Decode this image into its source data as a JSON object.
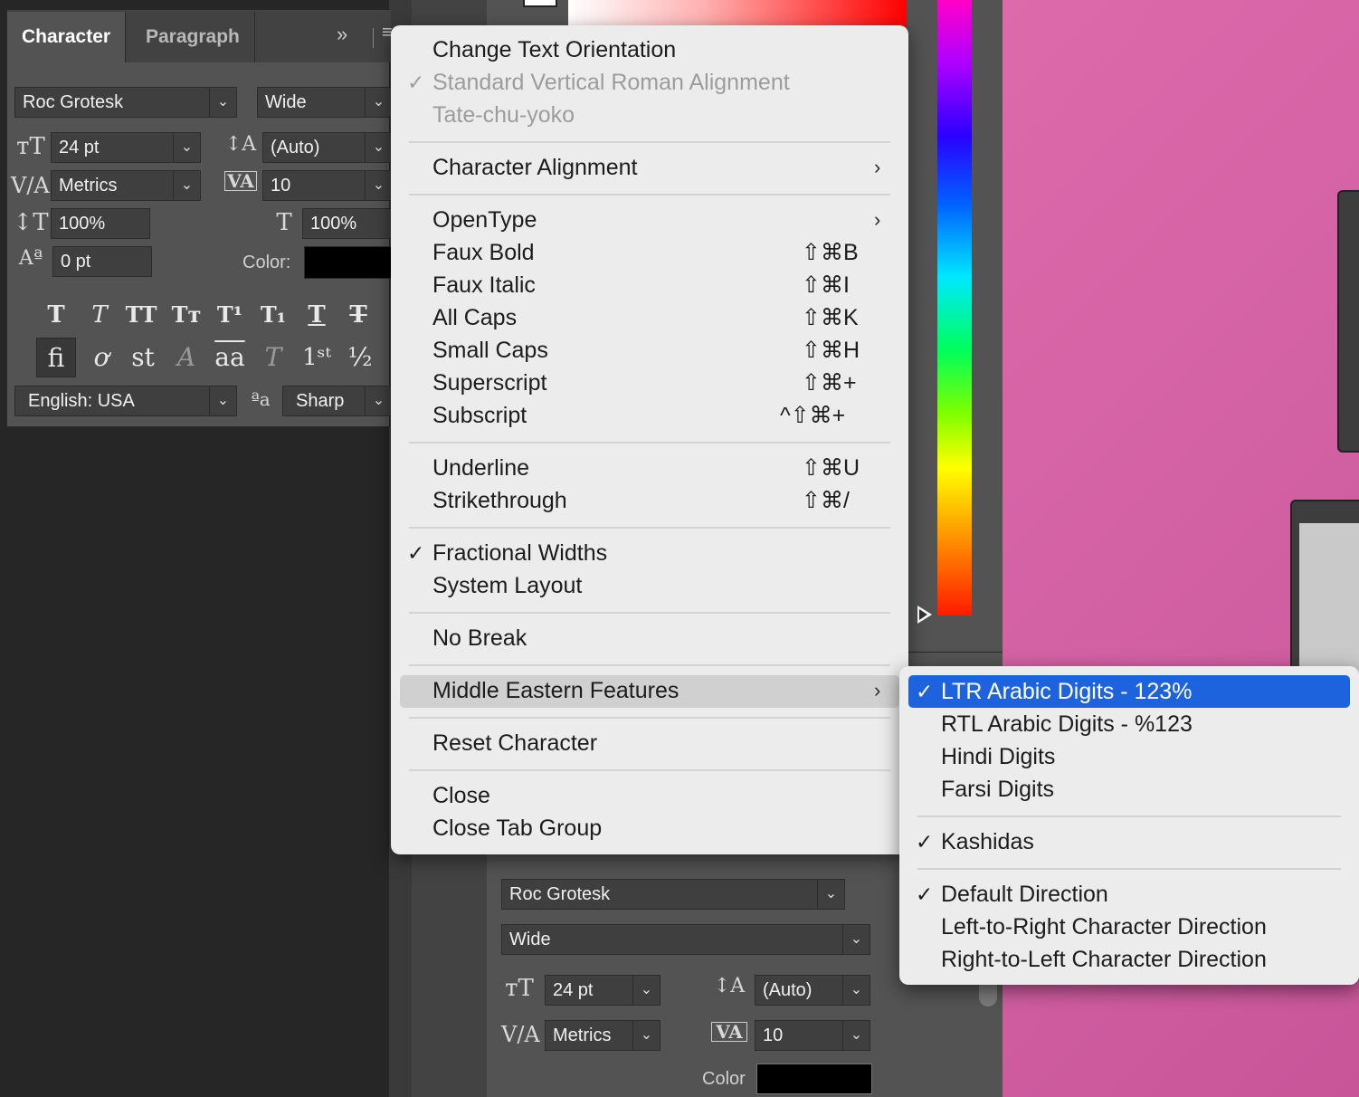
{
  "character_panel": {
    "tabs": [
      {
        "label": "Character"
      },
      {
        "label": "Paragraph"
      }
    ],
    "font_family": "Roc Grotesk",
    "font_style": "Wide",
    "font_size": "24 pt",
    "leading": "(Auto)",
    "kerning": "Metrics",
    "tracking": "10",
    "vertical_scale": "100%",
    "horizontal_scale": "100%",
    "baseline_shift": "0 pt",
    "color_label": "Color:",
    "color_value": "#000000",
    "language": "English: USA",
    "antialias": "Sharp"
  },
  "context_menu": {
    "items": [
      {
        "label": "Change Text Orientation"
      },
      {
        "label": "Standard Vertical Roman Alignment",
        "checked": true,
        "disabled": true
      },
      {
        "label": "Tate-chu-yoko",
        "disabled": true
      },
      {
        "label": "Character Alignment",
        "submenu": true
      },
      {
        "label": "OpenType",
        "submenu": true
      },
      {
        "label": "Faux Bold",
        "shortcut": "⇧⌘B"
      },
      {
        "label": "Faux Italic",
        "shortcut": "⇧⌘I"
      },
      {
        "label": "All Caps",
        "shortcut": "⇧⌘K"
      },
      {
        "label": "Small Caps",
        "shortcut": "⇧⌘H"
      },
      {
        "label": "Superscript",
        "shortcut": "⇧⌘+"
      },
      {
        "label": "Subscript",
        "shortcut": "^⇧⌘+"
      },
      {
        "label": "Underline",
        "shortcut": "⇧⌘U"
      },
      {
        "label": "Strikethrough",
        "shortcut": "⇧⌘/"
      },
      {
        "label": "Fractional Widths",
        "checked": true
      },
      {
        "label": "System Layout"
      },
      {
        "label": "No Break"
      },
      {
        "label": "Middle Eastern Features",
        "submenu": true,
        "highlighted": true
      },
      {
        "label": "Reset Character"
      },
      {
        "label": "Close"
      },
      {
        "label": "Close Tab Group"
      }
    ],
    "checkmark": "✓",
    "submenu_arrow": "›"
  },
  "submenu": {
    "items": [
      {
        "label": "LTR Arabic Digits - 123%",
        "checked": true,
        "highlighted": true
      },
      {
        "label": "RTL Arabic Digits - %123"
      },
      {
        "label": "Hindi Digits"
      },
      {
        "label": "Farsi Digits"
      },
      {
        "label": "Kashidas",
        "checked": true
      },
      {
        "label": "Default Direction",
        "checked": true
      },
      {
        "label": "Left-to-Right Character Direction"
      },
      {
        "label": "Right-to-Left Character Direction"
      }
    ]
  },
  "lower_panel": {
    "font_family": "Roc Grotesk",
    "font_style": "Wide",
    "font_size": "24 pt",
    "leading": "(Auto)",
    "kerning": "Metrics",
    "tracking": "10",
    "color_label": "Color",
    "color_value": "#000000"
  },
  "colors": {
    "menu_bg": "#ececec",
    "menu_highlight": "#d0d0d0",
    "submenu_highlight": "#1d63dd",
    "panel_bg": "#535353",
    "canvas_pink": "#d862a6"
  },
  "icons": {
    "dropdown": "chevron-down-icon",
    "expand": "double-chevron-right-icon",
    "panel_menu": "hamburger-icon"
  }
}
